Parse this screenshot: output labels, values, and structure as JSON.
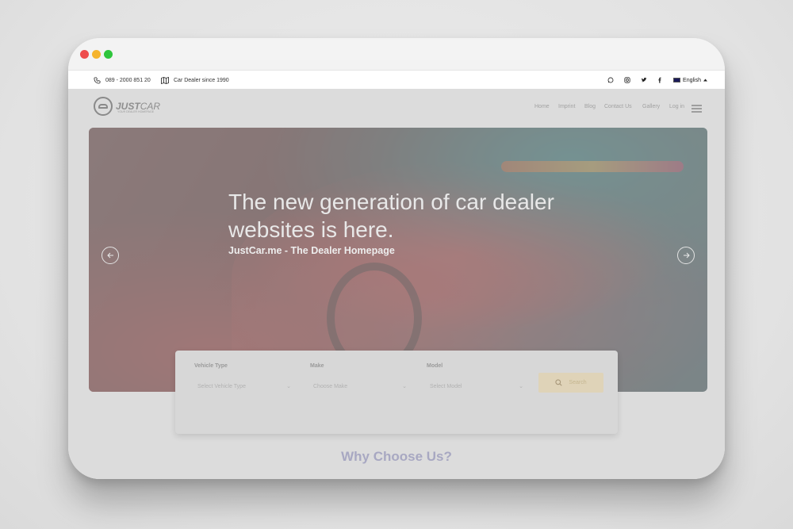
{
  "topbar": {
    "phone": "089 - 2000 851 20",
    "tagline": "Car Dealer since 1990",
    "language": "English"
  },
  "header": {
    "logo_just": "JUST",
    "logo_car": "CAR",
    "logo_tagline": "YOUR DEALER HOMEPAGE",
    "nav": [
      "Home",
      "Imprint",
      "Blog",
      "Contact Us",
      "Gallery",
      "Log in"
    ]
  },
  "hero": {
    "title": "The new generation of car dealer websites is here.",
    "subtitle": "JustCar.me - The Dealer Homepage"
  },
  "search": {
    "vehicle_type_label": "Vehicle Type",
    "vehicle_type_value": "Select Vehicle Type",
    "make_label": "Make",
    "make_value": "Choose Make",
    "model_label": "Model",
    "model_value": "Select Model",
    "button_label": "Search"
  },
  "section": {
    "why_title": "Why Choose Us?"
  },
  "colors": {
    "close": "#ee4d4d",
    "minimize": "#f5b42d",
    "maximize": "#2fc53c",
    "why_title": "#a8a8c2",
    "search_button": "#dfd3b8"
  }
}
